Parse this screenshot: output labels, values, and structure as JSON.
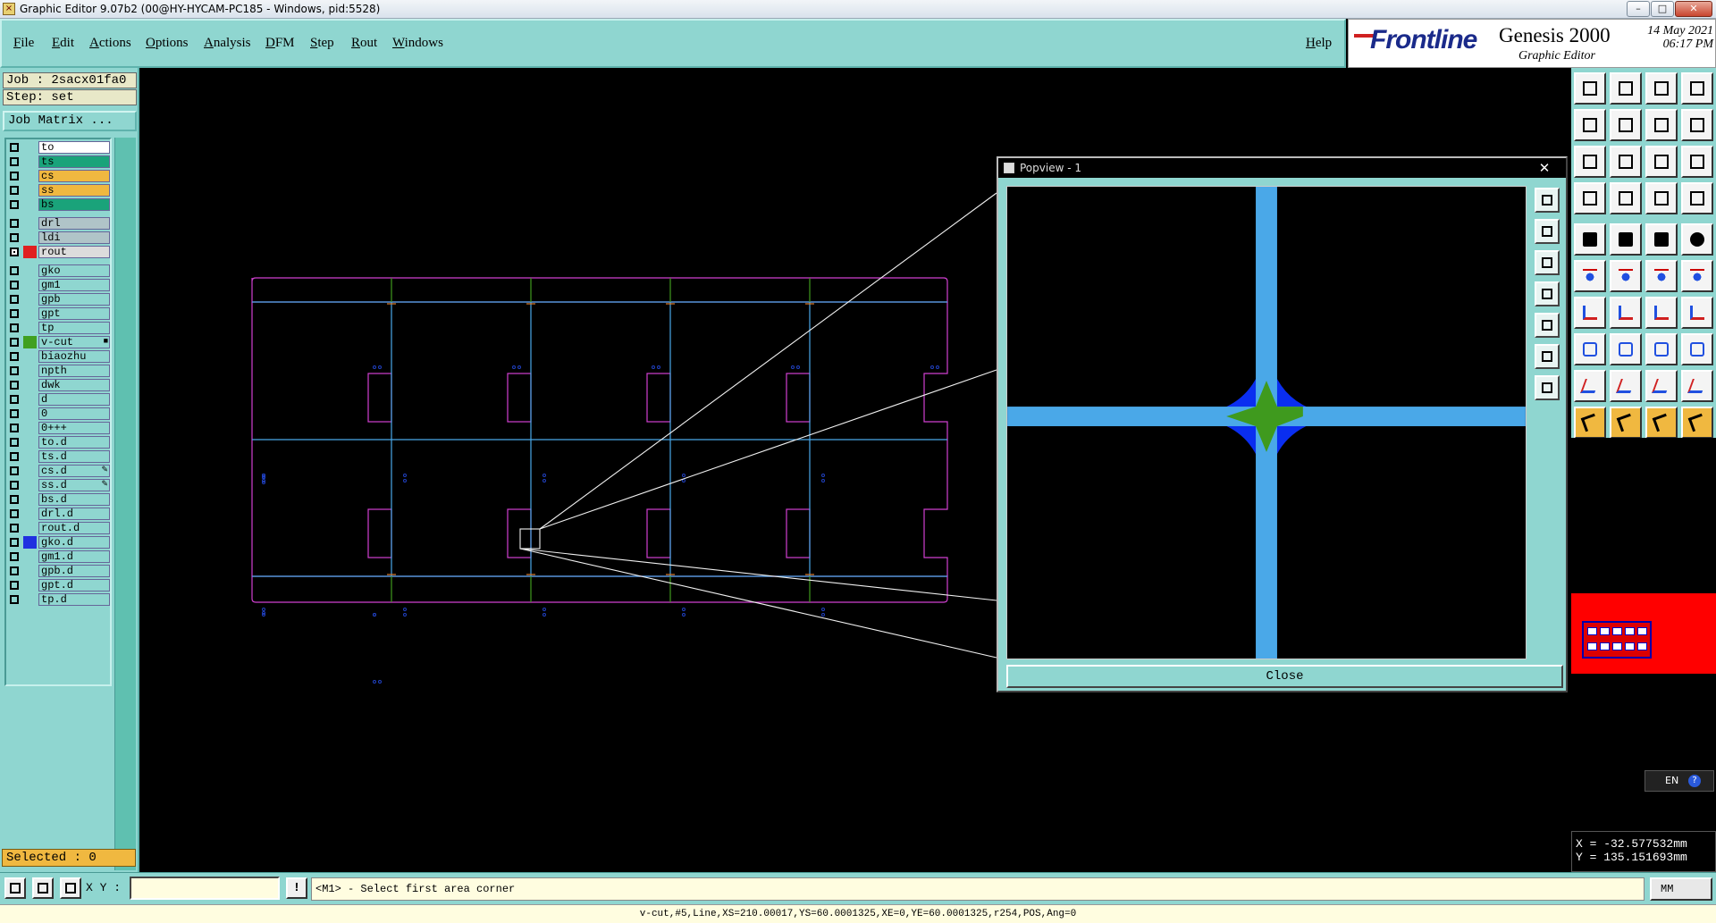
{
  "window": {
    "title": "Graphic Editor 9.07b2 (00@HY-HYCAM-PC185 - Windows, pid:5528)",
    "controls": [
      "–",
      "□",
      "✕"
    ]
  },
  "menu": [
    "File",
    "Edit",
    "Actions",
    "Options",
    "Analysis",
    "DFM",
    "Step",
    "Rout",
    "Windows"
  ],
  "help_label": "Help",
  "brand": {
    "logo": "Frontline",
    "product": "Genesis 2000",
    "subtitle": "Graphic Editor",
    "date": "14 May 2021",
    "time": "06:17 PM"
  },
  "job": {
    "job": "Job : 2sacx01fa0",
    "step": "Step: set",
    "matrix_button": "Job Matrix ..."
  },
  "layers": [
    {
      "name": "to",
      "bg": "#ffffff",
      "color": "",
      "on": false
    },
    {
      "name": "ts",
      "bg": "#1aa37a",
      "color": "",
      "on": false
    },
    {
      "name": "cs",
      "bg": "#f0b840",
      "color": "",
      "on": false
    },
    {
      "name": "ss",
      "bg": "#f0b840",
      "color": "",
      "on": false
    },
    {
      "name": "bs",
      "bg": "#1aa37a",
      "color": "",
      "on": false
    },
    {
      "name": "drl",
      "bg": "#b0c4c8",
      "color": "",
      "on": false,
      "gap": true
    },
    {
      "name": "ldi",
      "bg": "#b0c4c8",
      "color": "",
      "on": false
    },
    {
      "name": "rout",
      "bg": "#dcdcdc",
      "color": "#e02020",
      "on": true
    },
    {
      "name": "gko",
      "bg": "#8fd6d0",
      "color": "",
      "on": false,
      "gap": true
    },
    {
      "name": "gm1",
      "bg": "#8fd6d0",
      "color": "",
      "on": false
    },
    {
      "name": "gpb",
      "bg": "#8fd6d0",
      "color": "",
      "on": false
    },
    {
      "name": "gpt",
      "bg": "#8fd6d0",
      "color": "",
      "on": false
    },
    {
      "name": "tp",
      "bg": "#8fd6d0",
      "color": "",
      "on": false
    },
    {
      "name": "v-cut",
      "bg": "#8fd6d0",
      "color": "#40a020",
      "on": false,
      "mark": "■"
    },
    {
      "name": "biaozhu",
      "bg": "#8fd6d0",
      "color": "",
      "on": false
    },
    {
      "name": "npth",
      "bg": "#8fd6d0",
      "color": "",
      "on": false
    },
    {
      "name": "dwk",
      "bg": "#8fd6d0",
      "color": "",
      "on": false
    },
    {
      "name": "d",
      "bg": "#8fd6d0",
      "color": "",
      "on": false
    },
    {
      "name": "0",
      "bg": "#8fd6d0",
      "color": "",
      "on": false
    },
    {
      "name": "0+++",
      "bg": "#8fd6d0",
      "color": "",
      "on": false
    },
    {
      "name": "to.d",
      "bg": "#8fd6d0",
      "color": "",
      "on": false
    },
    {
      "name": "ts.d",
      "bg": "#8fd6d0",
      "color": "",
      "on": false
    },
    {
      "name": "cs.d",
      "bg": "#8fd6d0",
      "color": "",
      "on": false,
      "mark": "✎"
    },
    {
      "name": "ss.d",
      "bg": "#8fd6d0",
      "color": "",
      "on": false,
      "mark": "✎"
    },
    {
      "name": "bs.d",
      "bg": "#8fd6d0",
      "color": "",
      "on": false
    },
    {
      "name": "drl.d",
      "bg": "#8fd6d0",
      "color": "",
      "on": false
    },
    {
      "name": "rout.d",
      "bg": "#8fd6d0",
      "color": "",
      "on": false
    },
    {
      "name": "gko.d",
      "bg": "#8fd6d0",
      "color": "#2030e0",
      "on": false
    },
    {
      "name": "gm1.d",
      "bg": "#8fd6d0",
      "color": "",
      "on": false
    },
    {
      "name": "gpb.d",
      "bg": "#8fd6d0",
      "color": "",
      "on": false
    },
    {
      "name": "gpt.d",
      "bg": "#8fd6d0",
      "color": "",
      "on": false
    },
    {
      "name": "tp.d",
      "bg": "#8fd6d0",
      "color": "",
      "on": false
    }
  ],
  "selected": "Selected : 0",
  "popview": {
    "title": "Popview - 1",
    "close_x": "✕",
    "close_button": "Close"
  },
  "coords": {
    "x": "X = -32.577532mm",
    "y": "Y = 135.151693mm"
  },
  "lang": {
    "code": "EN",
    "help": "?"
  },
  "bottom": {
    "xy_label": "X Y :",
    "xy_value": "",
    "bang": "!",
    "prompt": "<M1> - Select first area corner",
    "units": "MM"
  },
  "status": "v-cut,#5,Line,XS=210.00017,YS=60.0001325,XE=0,YE=60.0001325,r254,POS,Ang=0",
  "colors": {
    "panel": "#8fd6d0",
    "magenta": "#d040d0",
    "cyan": "#4aa8e8",
    "green": "#3f9a1e",
    "blue": "#0a2ef0"
  }
}
